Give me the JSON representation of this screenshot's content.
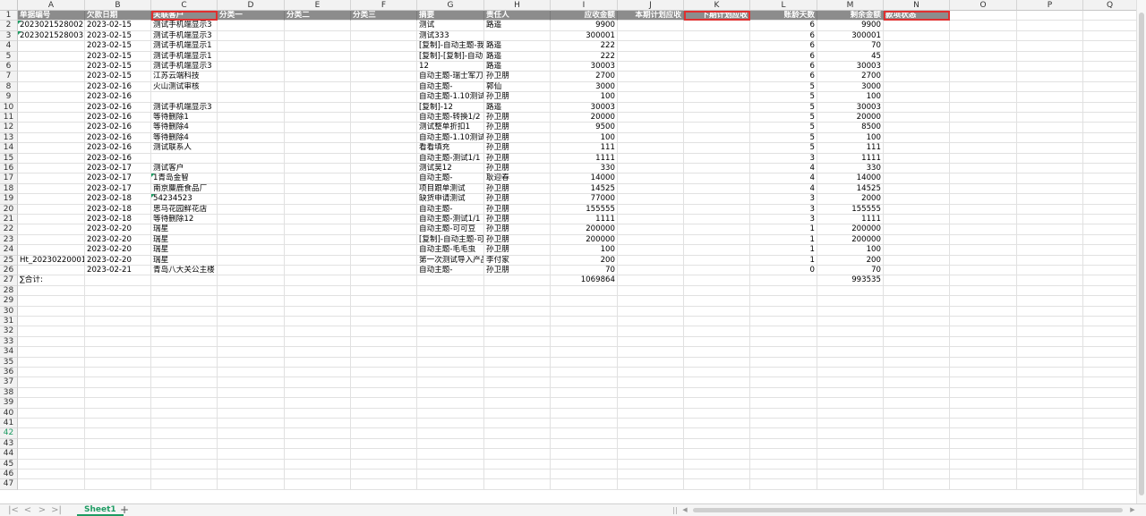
{
  "columns": [
    "A",
    "B",
    "C",
    "D",
    "E",
    "F",
    "G",
    "H",
    "I",
    "J",
    "K",
    "L",
    "M",
    "N",
    "O",
    "P",
    "Q"
  ],
  "header_row": [
    "单据编号",
    "欠款日期",
    "关联客户",
    "分类一",
    "分类二",
    "分类三",
    "摘要",
    "责任人",
    "应收金额",
    "本期计划应收",
    "下期计划应收",
    "账龄天数",
    "剩余金额",
    "款项状态"
  ],
  "highlighted_headers": [
    2,
    10,
    13
  ],
  "data_rows": [
    [
      "2023021528002",
      "2023-02-15",
      "测试手机端显示3",
      "",
      "",
      "",
      "测试",
      "路遥",
      "9900",
      "",
      "",
      "6",
      "9900",
      ""
    ],
    [
      "2023021528003",
      "2023-02-15",
      "测试手机端显示3",
      "",
      "",
      "",
      "测试333",
      "",
      "300001",
      "",
      "",
      "6",
      "300001",
      ""
    ],
    [
      "",
      "2023-02-15",
      "测试手机端显示1",
      "",
      "",
      "",
      "[复制]-自动主题-我",
      "路遥",
      "222",
      "",
      "",
      "6",
      "70",
      ""
    ],
    [
      "",
      "2023-02-15",
      "测试手机端显示1",
      "",
      "",
      "",
      "[复制]-[复制]-自动",
      "路遥",
      "222",
      "",
      "",
      "6",
      "45",
      ""
    ],
    [
      "",
      "2023-02-15",
      "测试手机端显示3",
      "",
      "",
      "",
      "12",
      "路遥",
      "30003",
      "",
      "",
      "6",
      "30003",
      ""
    ],
    [
      "",
      "2023-02-15",
      "江苏云端科技",
      "",
      "",
      "",
      "自动主题-瑞士军刀",
      "孙卫朋",
      "2700",
      "",
      "",
      "6",
      "2700",
      ""
    ],
    [
      "",
      "2023-02-16",
      "火山测试审核",
      "",
      "",
      "",
      "自动主题-",
      "郭仙",
      "3000",
      "",
      "",
      "5",
      "3000",
      ""
    ],
    [
      "",
      "2023-02-16",
      "",
      "",
      "",
      "",
      "自动主题-1.10测试",
      "孙卫朋",
      "100",
      "",
      "",
      "5",
      "100",
      ""
    ],
    [
      "",
      "2023-02-16",
      "测试手机端显示3",
      "",
      "",
      "",
      "[复制]-12",
      "路遥",
      "30003",
      "",
      "",
      "5",
      "30003",
      ""
    ],
    [
      "",
      "2023-02-16",
      "等待删除1",
      "",
      "",
      "",
      "自动主题-转换1/2",
      "孙卫朋",
      "20000",
      "",
      "",
      "5",
      "20000",
      ""
    ],
    [
      "",
      "2023-02-16",
      "等待删除4",
      "",
      "",
      "",
      "测试整单折扣1",
      "孙卫朋",
      "9500",
      "",
      "",
      "5",
      "8500",
      ""
    ],
    [
      "",
      "2023-02-16",
      "等待删除4",
      "",
      "",
      "",
      "自动主题-1.10测试",
      "孙卫朋",
      "100",
      "",
      "",
      "5",
      "100",
      ""
    ],
    [
      "",
      "2023-02-16",
      "测试联系人",
      "",
      "",
      "",
      "看看填充",
      "孙卫朋",
      "111",
      "",
      "",
      "5",
      "111",
      ""
    ],
    [
      "",
      "2023-02-16",
      "",
      "",
      "",
      "",
      "自动主题-测试1/1",
      "孙卫朋",
      "1111",
      "",
      "",
      "3",
      "1111",
      ""
    ],
    [
      "",
      "2023-02-17",
      "测试客户",
      "",
      "",
      "",
      "测试吴12",
      "孙卫朋",
      "330",
      "",
      "",
      "4",
      "330",
      ""
    ],
    [
      "",
      "2023-02-17",
      "1青岛金智",
      "",
      "",
      "",
      "自动主题-",
      "耿迎春",
      "14000",
      "",
      "",
      "4",
      "14000",
      ""
    ],
    [
      "",
      "2023-02-17",
      "南京麋鹿食品厂",
      "",
      "",
      "",
      "项目跟单测试",
      "孙卫朋",
      "14525",
      "",
      "",
      "4",
      "14525",
      ""
    ],
    [
      "",
      "2023-02-18",
      "54234523",
      "",
      "",
      "",
      "缺货申请测试",
      "孙卫朋",
      "77000",
      "",
      "",
      "3",
      "2000",
      ""
    ],
    [
      "",
      "2023-02-18",
      "思马花园鲜花店",
      "",
      "",
      "",
      "自动主题-",
      "孙卫朋",
      "155555",
      "",
      "",
      "3",
      "155555",
      ""
    ],
    [
      "",
      "2023-02-18",
      "等待删除12",
      "",
      "",
      "",
      "自动主题-测试1/1",
      "孙卫朋",
      "1111",
      "",
      "",
      "3",
      "1111",
      ""
    ],
    [
      "",
      "2023-02-20",
      "瑞星",
      "",
      "",
      "",
      "自动主题-可可豆",
      "孙卫朋",
      "200000",
      "",
      "",
      "1",
      "200000",
      ""
    ],
    [
      "",
      "2023-02-20",
      "瑞星",
      "",
      "",
      "",
      "[复制]-自动主题-可",
      "孙卫朋",
      "200000",
      "",
      "",
      "1",
      "200000",
      ""
    ],
    [
      "",
      "2023-02-20",
      "瑞星",
      "",
      "",
      "",
      "自动主题-毛毛虫",
      "孙卫朋",
      "100",
      "",
      "",
      "1",
      "100",
      ""
    ],
    [
      "Ht_20230220001",
      "2023-02-20",
      "瑞星",
      "",
      "",
      "",
      "第一次测试导入产品",
      "李付家",
      "200",
      "",
      "",
      "1",
      "200",
      ""
    ],
    [
      "",
      "2023-02-21",
      "青岛八大关公主楼",
      "",
      "",
      "",
      "自动主题-",
      "孙卫朋",
      "70",
      "",
      "",
      "0",
      "70",
      ""
    ]
  ],
  "total_row": {
    "label": "∑合计:",
    "receivable_total": "1069864",
    "remaining_total": "993535"
  },
  "row_count": 47,
  "selected_row": 42,
  "sheet_tab": "Sheet1",
  "add_sheet_symbol": "+",
  "nav_icons": [
    "first-sheet-icon",
    "prev-sheet-icon",
    "next-sheet-icon",
    "last-sheet-icon"
  ],
  "colors": {
    "header_bg": "#8c8c8c",
    "highlight_border": "#e03030",
    "accent": "#1e9c63"
  }
}
